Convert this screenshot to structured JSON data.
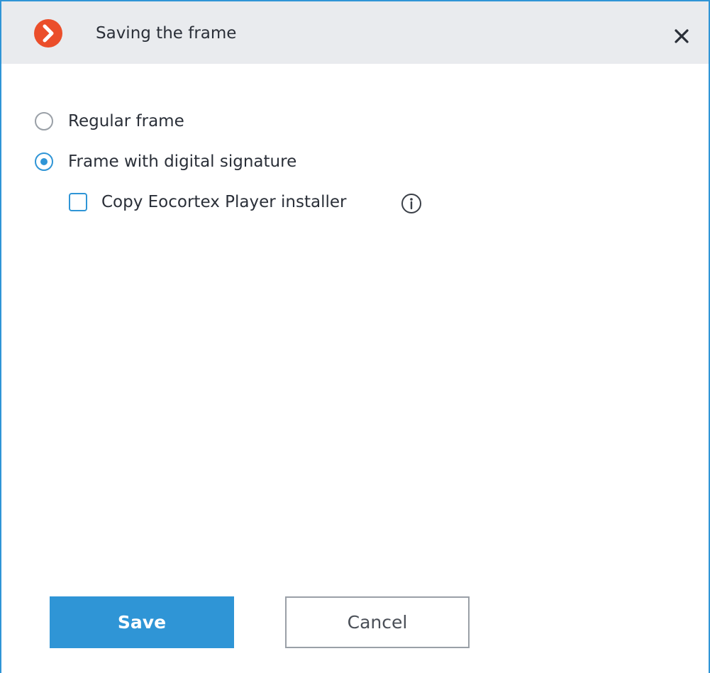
{
  "dialog": {
    "title": "Saving the frame",
    "app_icon": "eocortex-chevron-right-icon",
    "close_icon": "close-icon"
  },
  "options": {
    "regular_frame": {
      "label": "Regular frame",
      "checked": false
    },
    "digital_signature": {
      "label": "Frame with digital signature",
      "checked": true
    },
    "copy_installer": {
      "label": "Copy Eocortex Player installer",
      "checked": false,
      "info_icon": "info-icon"
    }
  },
  "buttons": {
    "save_label": "Save",
    "cancel_label": "Cancel"
  },
  "colors": {
    "accent": "#2f95d6",
    "app_icon_bg": "#eb4e2a",
    "titlebar_bg": "#e9ebee",
    "text": "#2a2f38"
  }
}
